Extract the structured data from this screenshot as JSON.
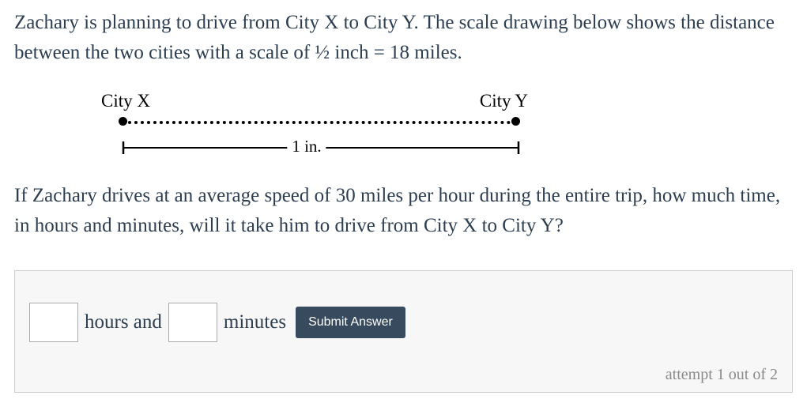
{
  "question": {
    "paragraph1": "Zachary is planning to drive from City X to City Y. The scale drawing below shows the distance between the two cities with a scale of ½ inch = 18 miles.",
    "paragraph2": "If Zachary drives at an average speed of 30 miles per hour during the entire trip, how much time, in hours and minutes, will it take him to drive from City X to City Y?"
  },
  "diagram": {
    "cityX": "City X",
    "cityY": "City Y",
    "scaleLabel": "1 in."
  },
  "answer": {
    "hoursLabel": "hours and",
    "minutesLabel": "minutes",
    "hoursValue": "",
    "minutesValue": "",
    "submitLabel": "Submit Answer",
    "attemptText": "attempt 1 out of 2"
  }
}
